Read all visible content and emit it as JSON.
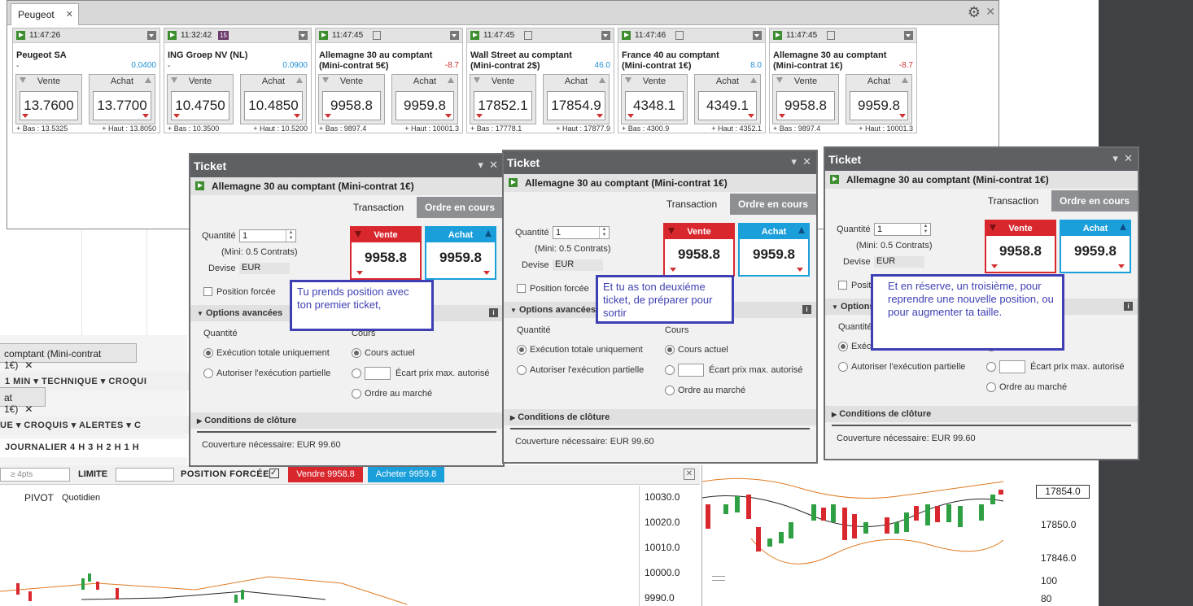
{
  "watchlist": {
    "tab_label": "Peugeot",
    "cards": [
      {
        "time": "11:47:26",
        "badge": "",
        "has_doc": false,
        "name": "Peugeot SA",
        "sub": "-",
        "change": "0.0400",
        "change_dir": "pos",
        "sell_label": "Vente",
        "buy_label": "Achat",
        "sell": "13.7600",
        "buy": "13.7700",
        "low": "+ Bas : 13.5325",
        "high": "+ Haut : 13.8050"
      },
      {
        "time": "11:32:42",
        "badge": "15",
        "has_doc": false,
        "name": "ING Groep NV (NL)",
        "sub": "-",
        "change": "0.0900",
        "change_dir": "pos",
        "sell_label": "Vente",
        "buy_label": "Achat",
        "sell": "10.4750",
        "buy": "10.4850",
        "low": "+ Bas : 10.3500",
        "high": "+ Haut : 10.5200"
      },
      {
        "time": "11:47:45",
        "badge": "",
        "has_doc": true,
        "name": "Allemagne 30 au comptant (Mini-contrat 5€)",
        "sub": "",
        "change": "-8.7",
        "change_dir": "neg",
        "sell_label": "Vente",
        "buy_label": "Achat",
        "sell": "9958.8",
        "buy": "9959.8",
        "low": "+ Bas : 9897.4",
        "high": "+ Haut : 10001.3"
      },
      {
        "time": "11:47:45",
        "badge": "",
        "has_doc": true,
        "name": "Wall Street au comptant (Mini-contrat 2$)",
        "sub": "",
        "change": "46.0",
        "change_dir": "pos",
        "sell_label": "Vente",
        "buy_label": "Achat",
        "sell": "17852.1",
        "buy": "17854.9",
        "low": "+ Bas : 17778.1",
        "high": "+ Haut : 17877.9"
      },
      {
        "time": "11:47:46",
        "badge": "",
        "has_doc": true,
        "name": "France 40 au comptant (Mini-contrat 1€)",
        "sub": "",
        "change": "8.0",
        "change_dir": "pos",
        "sell_label": "Vente",
        "buy_label": "Achat",
        "sell": "4348.1",
        "buy": "4349.1",
        "low": "+ Bas : 4300.9",
        "high": "+ Haut : 4352.1"
      },
      {
        "time": "11:47:45",
        "badge": "",
        "has_doc": true,
        "name": "Allemagne 30 au comptant (Mini-contrat 1€)",
        "sub": "",
        "change": "-8.7",
        "change_dir": "neg",
        "sell_label": "Vente",
        "buy_label": "Achat",
        "sell": "9958.8",
        "buy": "9959.8",
        "low": "+ Bas : 9897.4",
        "high": "+ Haut : 10001.3"
      }
    ]
  },
  "background": {
    "tab1": "comptant (Mini-contrat 1€)",
    "toolbar1": "1 MIN ▾   TECHNIQUE ▾   CROQUI",
    "tab2": "at 1€)",
    "toolbar2": "UE ▾   CROQUIS ▾   ALERTES ▾   C",
    "periods": "JOURNALIER    4 H    3 H    2 H    1 H",
    "order_bar": {
      "stop": "≥ 4pts",
      "limit": "LIMITE",
      "forced": "POSITION FORCÉE",
      "sell_btn": "Vendre 9958.8",
      "buy_btn": "Acheter 9959.8"
    },
    "pivot": "PIVOT",
    "pivot_period": "Quotidien",
    "left_axis": [
      "10030.0",
      "10020.0",
      "10010.0",
      "10000.0",
      "9990.0"
    ],
    "right_axis": [
      "17854.0",
      "17850.0",
      "17846.0",
      "100",
      "80"
    ]
  },
  "ticket_common": {
    "title": "Ticket",
    "instrument": "Allemagne 30 au comptant (Mini-contrat 1€)",
    "tab_transaction": "Transaction",
    "tab_orders": "Ordre en cours",
    "qty_label": "Quantité",
    "qty_value": "1",
    "min_text": "(Mini: 0.5 Contrats)",
    "currency_label": "Devise",
    "currency": "EUR",
    "sell_label": "Vente",
    "buy_label": "Achat",
    "sell": "9958.8",
    "buy": "9959.8",
    "forced_label": "Position forcée",
    "advanced_label": "Options avancées",
    "quantity_hdr": "Quantité",
    "price_hdr": "Cours",
    "exec_full": "Exécution totale uniquement",
    "exec_partial": "Autoriser l'exécution partielle",
    "price_current": "Cours actuel",
    "price_max": "Écart prix max. autorisé",
    "price_market": "Ordre au marché",
    "close_conditions": "Conditions de clôture",
    "coverage": "Couverture nécessaire:  EUR 99.60",
    "exec_full_trunc": "Exécutio"
  },
  "notes": {
    "n1": "Tu prends position avec ton premier ticket,",
    "n2": "Et tu as ton deuxiéme ticket, de préparer pour sortir",
    "n3": "Et en réserve, un troisième, pour reprendre une nouvelle position, ou pour augmenter ta taille."
  }
}
